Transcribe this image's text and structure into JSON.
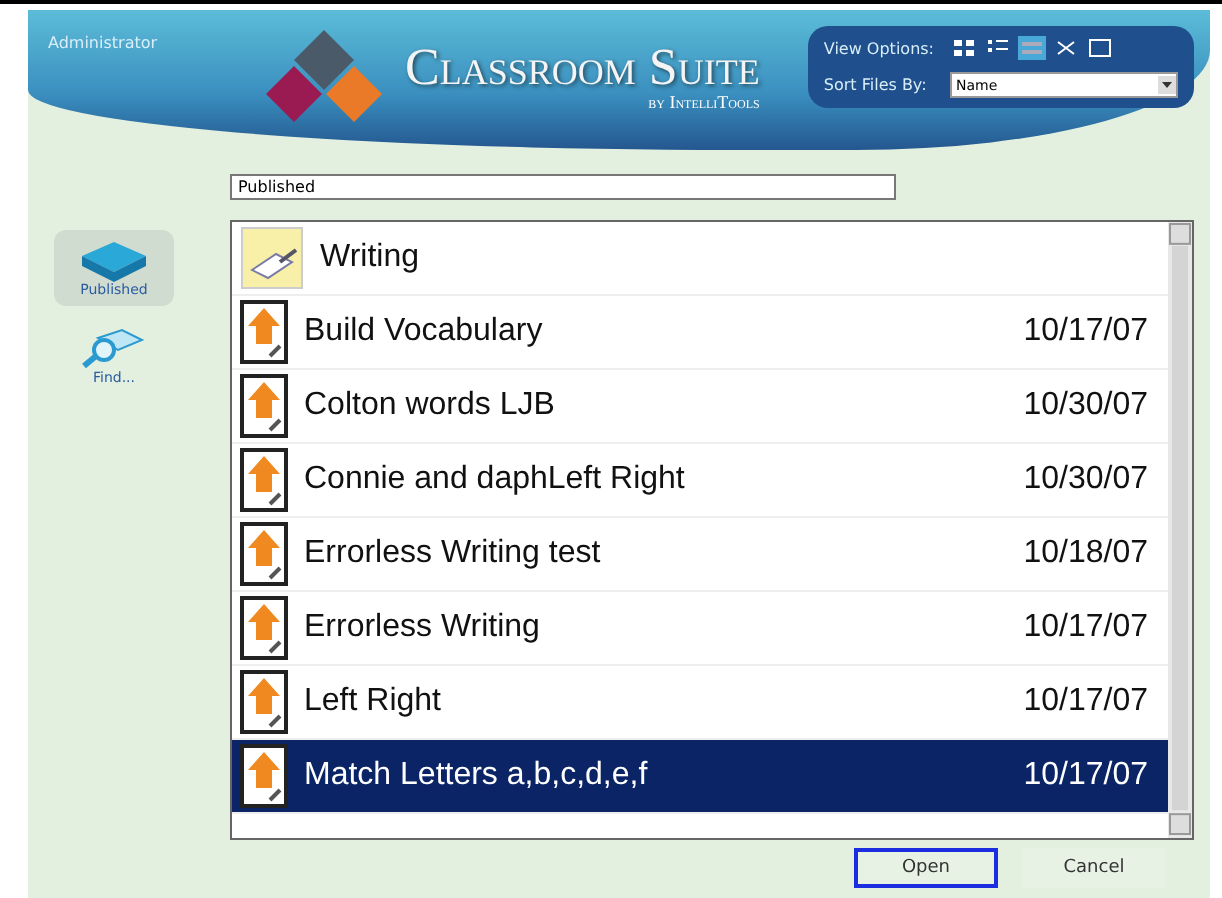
{
  "header": {
    "user": "Administrator",
    "title": "Classroom Suite",
    "byline": "by IntelliTools",
    "view_options_label": "View Options:",
    "view_buttons": [
      {
        "kind": "icons",
        "selected": false
      },
      {
        "kind": "list",
        "selected": false
      },
      {
        "kind": "details",
        "selected": true
      },
      {
        "kind": "thumbs",
        "selected": false
      },
      {
        "kind": "expand",
        "selected": false
      }
    ],
    "sort_label": "Sort Files By:",
    "sort_value": "Name"
  },
  "sidebar": [
    {
      "kind": "book",
      "label": "Published",
      "selected": true
    },
    {
      "kind": "find",
      "label": "Find...",
      "selected": false
    }
  ],
  "path": "Published",
  "files": [
    {
      "kind": "folder",
      "name": "Writing",
      "selected": false
    },
    {
      "kind": "activity",
      "name": "Build Vocabulary",
      "date": "10/17/07",
      "selected": false
    },
    {
      "kind": "activity",
      "name": "Colton words LJB",
      "date": "10/30/07",
      "selected": false
    },
    {
      "kind": "activity",
      "name": "Connie and daphLeft Right",
      "date": "10/30/07",
      "selected": false
    },
    {
      "kind": "activity",
      "name": "Errorless Writing test",
      "date": "10/18/07",
      "selected": false
    },
    {
      "kind": "activity",
      "name": "Errorless Writing",
      "date": "10/17/07",
      "selected": false
    },
    {
      "kind": "activity",
      "name": "Left Right",
      "date": "10/17/07",
      "selected": false
    },
    {
      "kind": "activity",
      "name": "Match Letters a,b,c,d,e,f",
      "date": "10/17/07",
      "selected": true
    }
  ],
  "buttons": [
    {
      "label": "Open",
      "selected": true
    },
    {
      "label": "Cancel",
      "selected": false
    }
  ]
}
